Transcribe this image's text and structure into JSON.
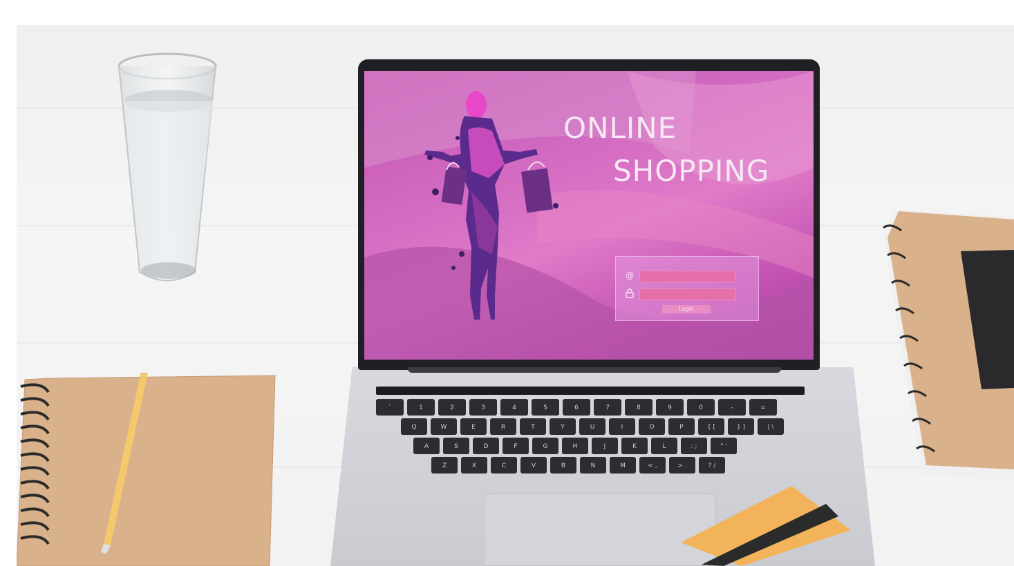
{
  "screen": {
    "title_line1": "ONLINE",
    "title_line2": "SHOPPING",
    "login": {
      "email_icon": "at-sign-icon",
      "email_symbol": "@",
      "password_icon": "lock-icon",
      "button_label": "Login"
    }
  },
  "keyboard": {
    "row_numbers": [
      "~",
      "!",
      "@",
      "#",
      "$",
      "%",
      "^",
      "&",
      "*",
      "(",
      ")",
      "_",
      "+"
    ],
    "row_numbers_sub": [
      "`",
      "1",
      "2",
      "3",
      "4",
      "5",
      "6",
      "7",
      "8",
      "9",
      "0",
      "-",
      "="
    ],
    "row_qwerty": [
      "Q",
      "W",
      "E",
      "R",
      "T",
      "Y",
      "U",
      "I",
      "O",
      "P",
      "{ [",
      "} ]",
      "| \\"
    ],
    "row_asdf": [
      "A",
      "S",
      "D",
      "F",
      "G",
      "H",
      "J",
      "K",
      "L",
      ": ;",
      "\" '"
    ],
    "row_zxcv": [
      "Z",
      "X",
      "C",
      "V",
      "B",
      "N",
      "M",
      "< ,",
      "> .",
      "? /"
    ]
  },
  "colors": {
    "screen_pink": "#d068c0",
    "login_field": "#e56fa9",
    "card_orange": "#f2b35a",
    "notebook_kraft": "#d9b18b"
  }
}
